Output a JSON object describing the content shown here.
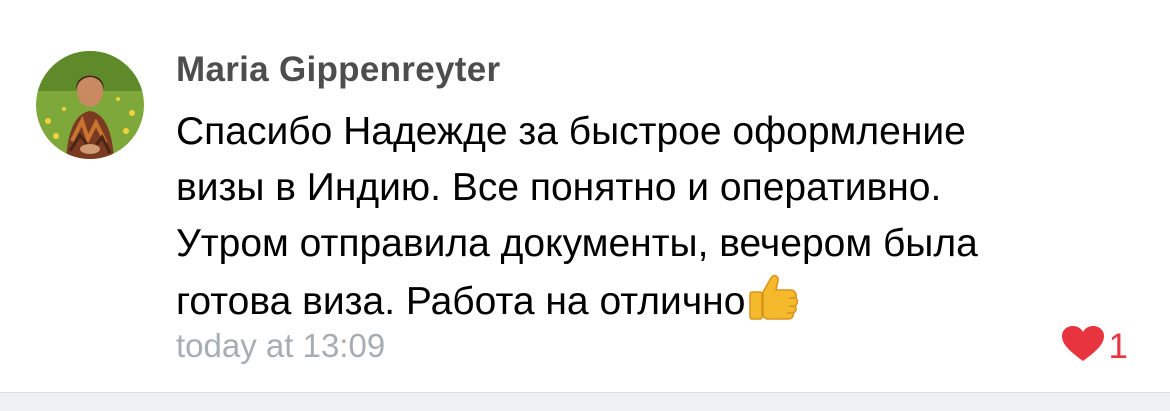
{
  "comment": {
    "author": "Maria Gippenreyter",
    "text_lines": [
      "Спасибо Надежде за быстрое оформление",
      "визы в Индию. Все понятно и оперативно.",
      "Утром отправила документы, вечером была",
      "готова виза. Работа на отлично"
    ],
    "emoji_icon": "thumbs-up-icon",
    "timestamp": "today at 13:09",
    "likes": {
      "icon": "heart-icon",
      "count": "1",
      "color": "#e8343f"
    }
  },
  "colors": {
    "author": "#4d4d4d",
    "text": "#000000",
    "timestamp": "#a8adb3",
    "separator": "#eef0f2"
  }
}
